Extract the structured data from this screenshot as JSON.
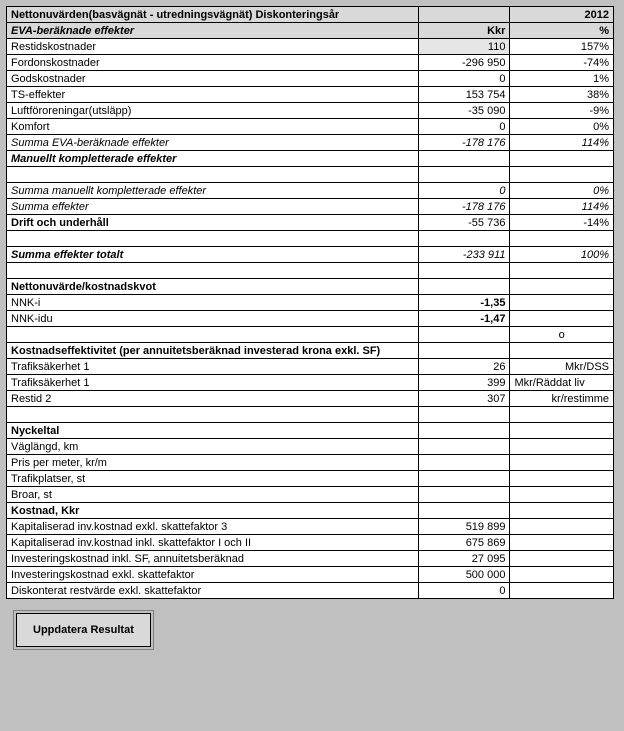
{
  "header": {
    "main_title": "Nettonuvärden(basvägnät - utredningsvägnät)    Diskonteringsår",
    "year": "2012",
    "sub_title": "EVA-beräknade effekter",
    "col_b": "Kkr",
    "col_c": "%"
  },
  "eva": [
    {
      "label": "Restidskostnader",
      "kkr": "110",
      "pct": "157%",
      "shaded": true
    },
    {
      "label": "Fordonskostnader",
      "kkr": "-296 950",
      "pct": "-74%"
    },
    {
      "label": "Godskostnader",
      "kkr": "0",
      "pct": "1%"
    },
    {
      "label": "TS-effekter",
      "kkr": "153 754",
      "pct": "38%"
    },
    {
      "label": "Luftföroreningar(utsläpp)",
      "kkr": "-35 090",
      "pct": "-9%"
    },
    {
      "label": "Komfort",
      "kkr": "0",
      "pct": "0%"
    }
  ],
  "eva_sum": {
    "label": "Summa EVA-beräknade effekter",
    "kkr": "-178 176",
    "pct": "114%"
  },
  "manual_hdr": "Manuellt kompletterade effekter",
  "manual_sum": {
    "label": "Summa manuellt kompletterade effekter",
    "kkr": "0",
    "pct": "0%"
  },
  "effects_sum": {
    "label": "Summa effekter",
    "kkr": "-178 176",
    "pct": "114%"
  },
  "drift": {
    "label": "Drift och underhåll",
    "kkr": "-55 736",
    "pct": "-14%"
  },
  "total": {
    "label": "Summa effekter totalt",
    "kkr": "-233 911",
    "pct": "100%"
  },
  "npv_hdr": "Nettonuvärde/kostnadskvot",
  "npv": [
    {
      "label": "NNK-i",
      "val": "-1,35"
    },
    {
      "label": "NNK-idu",
      "val": "-1,47"
    }
  ],
  "npv_extra": "o",
  "cost_eff_hdr": "Kostnadseffektivitet (per annuitetsberäknad investerad krona exkl. SF)",
  "cost_eff": [
    {
      "label": "Trafiksäkerhet 1",
      "val": "26",
      "unit": "Mkr/DSS"
    },
    {
      "label": "Trafiksäkerhet 1",
      "val": "399",
      "unit": "Mkr/Räddat liv"
    },
    {
      "label": "Restid 2",
      "val": "307",
      "unit": "kr/restimme"
    }
  ],
  "key_hdr": "Nyckeltal",
  "key": [
    {
      "label": "Väglängd, km"
    },
    {
      "label": "Pris per meter, kr/m"
    },
    {
      "label": "Trafikplatser, st"
    },
    {
      "label": "Broar, st"
    }
  ],
  "cost_hdr": "Kostnad, Kkr",
  "cost": [
    {
      "label": "Kapitaliserad inv.kostnad exkl. skattefaktor 3",
      "val": "519 899"
    },
    {
      "label": "Kapitaliserad inv.kostnad inkl. skattefaktor I och II",
      "val": "675 869"
    },
    {
      "label": "Investeringskostnad inkl. SF, annuitetsberäknad",
      "val": "27 095"
    },
    {
      "label": "Investeringskostnad exkl. skattefaktor",
      "val": "500 000"
    },
    {
      "label": "Diskonterat restvärde exkl. skattefaktor",
      "val": "0"
    }
  ],
  "button": "Uppdatera Resultat"
}
